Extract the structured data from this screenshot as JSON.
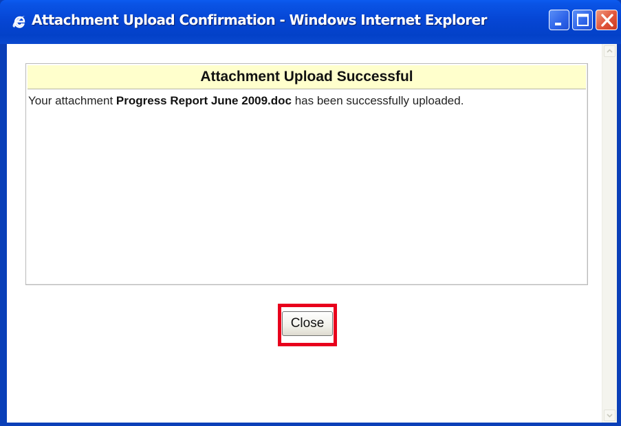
{
  "window": {
    "title": "Attachment Upload Confirmation - Windows Internet Explorer",
    "icon": "internet-explorer-icon",
    "controls": [
      "minimize-icon",
      "maximize-icon",
      "close-icon"
    ]
  },
  "panel": {
    "header": "Attachment Upload Successful",
    "message_prefix": "Your attachment ",
    "filename": "Progress Report June 2009.doc",
    "message_suffix": " has been successfully uploaded."
  },
  "actions": {
    "close_label": "Close"
  },
  "colors": {
    "title_bar": "#0646d4",
    "panel_header_bg": "#ffffcc",
    "highlight_border": "#e8001c"
  }
}
